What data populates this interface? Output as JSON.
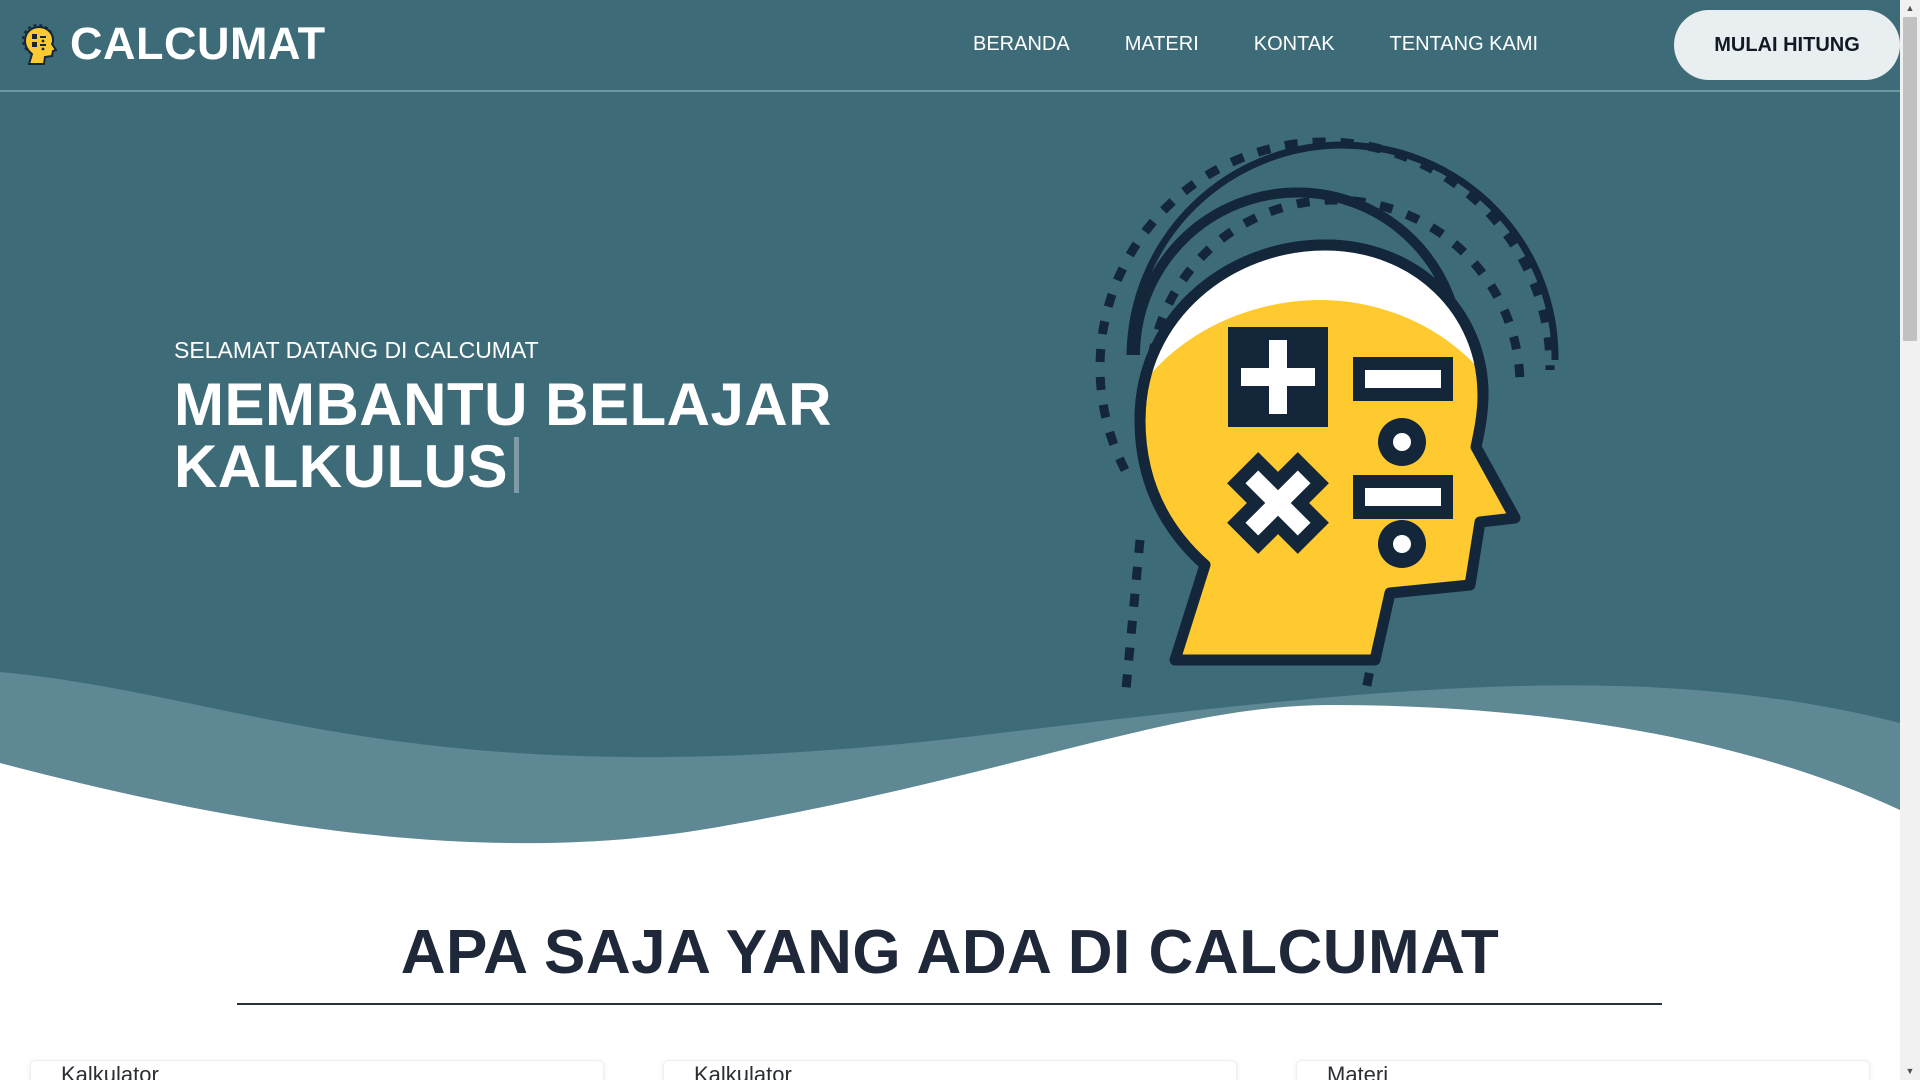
{
  "header": {
    "brand_name": "CALCUMAT",
    "nav": [
      "BERANDA",
      "MATERI",
      "KONTAK",
      "TENTANG KAMI"
    ],
    "cta_label": "MULAI HITUNG"
  },
  "hero": {
    "eyebrow": "SELAMAT DATANG DI CALCUMAT",
    "title_line1": "MEMBANTU BELAJAR",
    "title_line2": "KALKULUS"
  },
  "features": {
    "title": "APA SAJA YANG ADA DI CALCUMAT",
    "cards": [
      {
        "title": "Kalkulator"
      },
      {
        "title": "Kalkulator"
      },
      {
        "title": "Materi"
      }
    ]
  },
  "icons": {
    "brand": "head-calculator-icon",
    "hero": "head-math-symbols-icon",
    "scroll_up": "triangle-up-icon",
    "scroll_down": "triangle-down-icon"
  },
  "colors": {
    "hero_bg": "#3e6b78",
    "accent_yellow": "#ffc930",
    "outline_navy": "#142639",
    "heading_dark": "#1e2838",
    "cta_bg": "#e9eef0"
  }
}
